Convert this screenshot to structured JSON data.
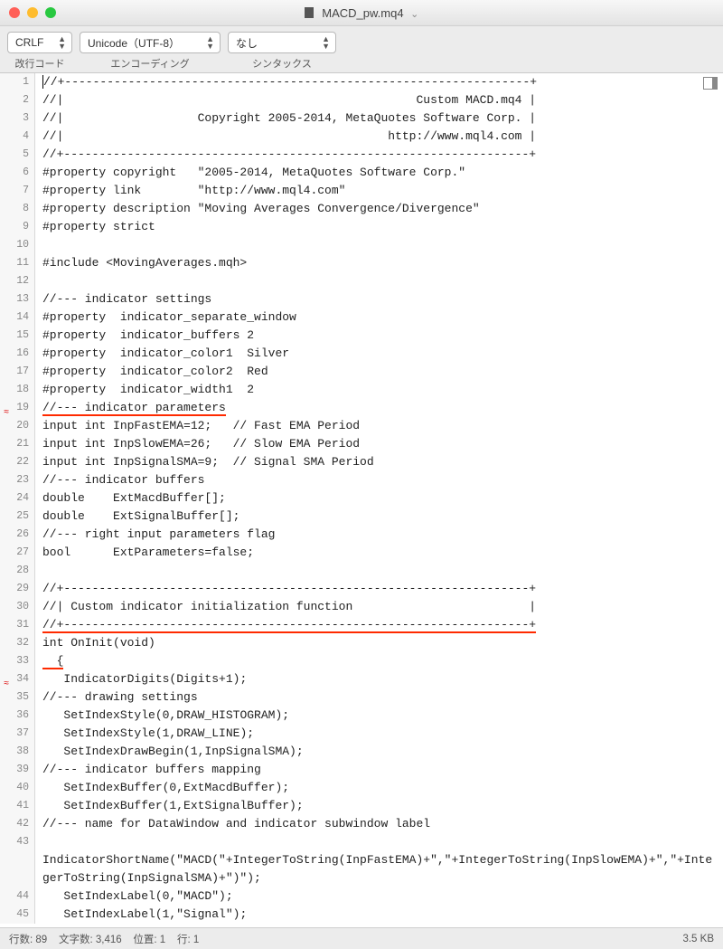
{
  "titlebar": {
    "filename": "MACD_pw.mq4"
  },
  "toolbar": {
    "line_ending": {
      "value": "CRLF",
      "label": "改行コード"
    },
    "encoding": {
      "value": "Unicode（UTF-8）",
      "label": "エンコーディング"
    },
    "syntax": {
      "value": "なし",
      "label": "シンタックス"
    }
  },
  "code_lines": [
    "//+------------------------------------------------------------------+",
    "//|                                                  Custom MACD.mq4 |",
    "//|                   Copyright 2005-2014, MetaQuotes Software Corp. |",
    "//|                                              http://www.mql4.com |",
    "//+------------------------------------------------------------------+",
    "#property copyright   \"2005-2014, MetaQuotes Software Corp.\"",
    "#property link        \"http://www.mql4.com\"",
    "#property description \"Moving Averages Convergence/Divergence\"",
    "#property strict",
    "",
    "#include <MovingAverages.mqh>",
    "",
    "//--- indicator settings",
    "#property  indicator_separate_window",
    "#property  indicator_buffers 2",
    "#property  indicator_color1  Silver",
    "#property  indicator_color2  Red",
    "#property  indicator_width1  2",
    "//--- indicator parameters",
    "input int InpFastEMA=12;   // Fast EMA Period",
    "input int InpSlowEMA=26;   // Slow EMA Period",
    "input int InpSignalSMA=9;  // Signal SMA Period",
    "//--- indicator buffers",
    "double    ExtMacdBuffer[];",
    "double    ExtSignalBuffer[];",
    "//--- right input parameters flag",
    "bool      ExtParameters=false;",
    "",
    "//+------------------------------------------------------------------+",
    "//| Custom indicator initialization function                         |",
    "//+------------------------------------------------------------------+",
    "int OnInit(void)",
    "  {",
    "   IndicatorDigits(Digits+1);",
    "//--- drawing settings",
    "   SetIndexStyle(0,DRAW_HISTOGRAM);",
    "   SetIndexStyle(1,DRAW_LINE);",
    "   SetIndexDrawBegin(1,InpSignalSMA);",
    "//--- indicator buffers mapping",
    "   SetIndexBuffer(0,ExtMacdBuffer);",
    "   SetIndexBuffer(1,ExtSignalBuffer);",
    "//--- name for DataWindow and indicator subwindow label",
    "   IndicatorShortName(\"MACD(\"+IntegerToString(InpFastEMA)+\",\"+IntegerToString(InpSlowEMA)+\",\"+IntegerToString(InpSignalSMA)+\")\");",
    "   SetIndexLabel(0,\"MACD\");",
    "   SetIndexLabel(1,\"Signal\");"
  ],
  "red_underline_rows": [
    19,
    31,
    33
  ],
  "squiggle_rows": [
    19,
    34
  ],
  "statusbar": {
    "lines": "行数: 89",
    "chars": "文字数: 3,416",
    "pos": "位置: 1",
    "row": "行: 1",
    "size": "3.5 KB"
  }
}
